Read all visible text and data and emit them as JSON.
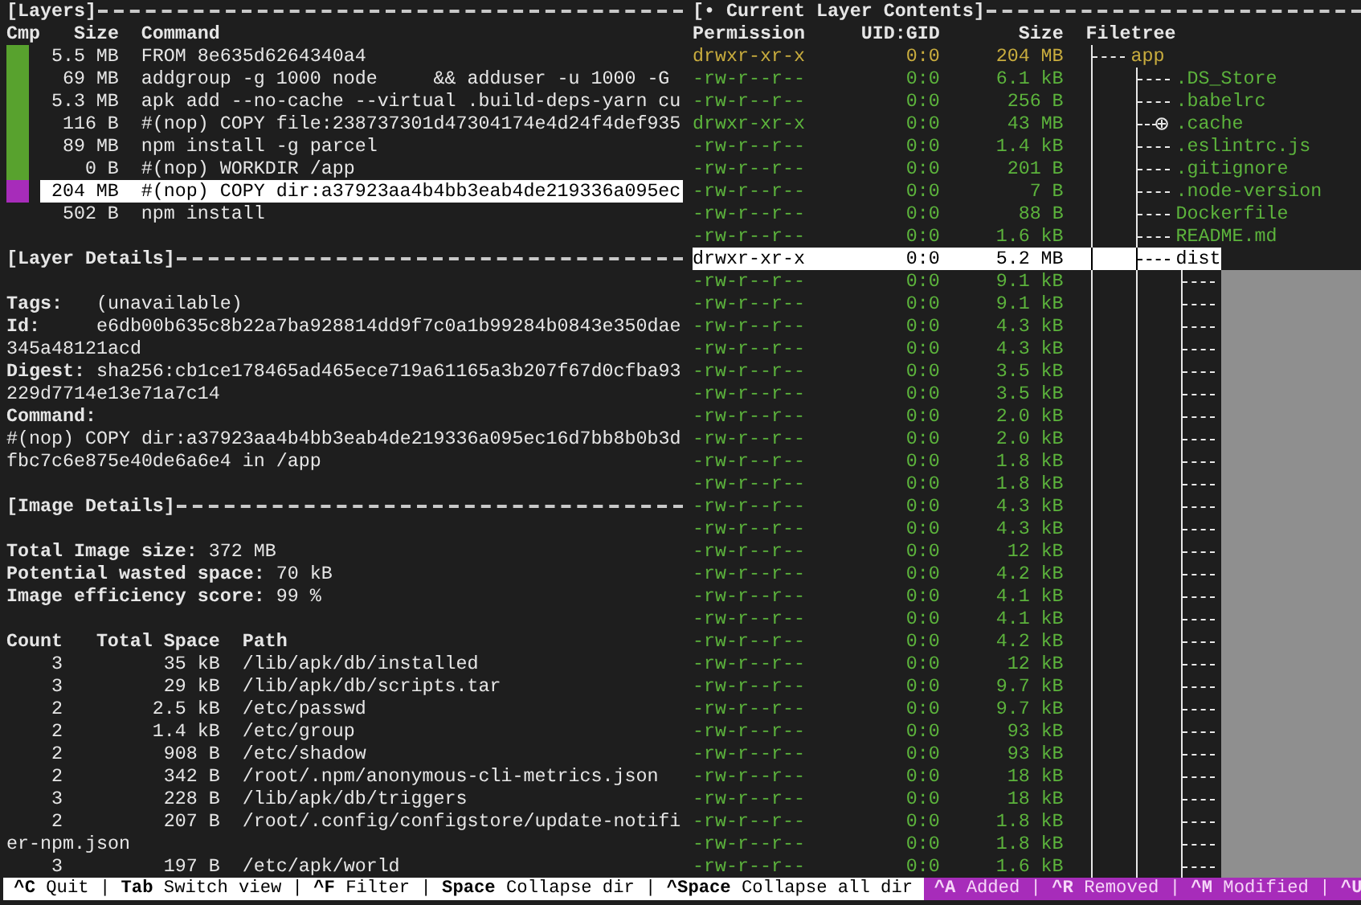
{
  "layers_pane": {
    "title": "[Layers]",
    "columns": [
      "Cmp",
      "Size",
      "Command"
    ],
    "rows": [
      {
        "color": "#58a22e",
        "size": "5.5 MB",
        "command": "FROM 8e635d6264340a4",
        "selected": false
      },
      {
        "color": "#58a22e",
        "size": "69 MB",
        "command": "addgroup -g 1000 node     && adduser -u 1000 -G",
        "selected": false
      },
      {
        "color": "#58a22e",
        "size": "5.3 MB",
        "command": "apk add --no-cache --virtual .build-deps-yarn cu",
        "selected": false
      },
      {
        "color": "#58a22e",
        "size": "116 B",
        "command": "#(nop) COPY file:238737301d47304174e4d24f4def935",
        "selected": false
      },
      {
        "color": "#58a22e",
        "size": "89 MB",
        "command": "npm install -g parcel",
        "selected": false
      },
      {
        "color": "#58a22e",
        "size": "0 B",
        "command": "#(nop) WORKDIR /app",
        "selected": false
      },
      {
        "color": "#a72cba",
        "size": "204 MB",
        "command": "#(nop) COPY dir:a37923aa4b4bb3eab4de219336a095ec",
        "selected": true
      },
      {
        "size": "502 B",
        "command": "npm install",
        "selected": false
      }
    ]
  },
  "layer_details": {
    "title": "[Layer Details]",
    "fields": [
      {
        "kind": "inline",
        "label": "Tags:",
        "lines": [
          "(unavailable)"
        ]
      },
      {
        "kind": "inline",
        "label": "Id:",
        "lines": [
          "e6db00b635c8b22a7ba928814dd9f7c0a1b99284b0843e350dae",
          "345a48121acd"
        ]
      },
      {
        "kind": "inline",
        "label": "Digest:",
        "lines": [
          "sha256:cb1ce178465ad465ece719a61165a3b207f67d0cfba93",
          "229d7714e13e71a7c14"
        ]
      },
      {
        "kind": "block",
        "label": "Command:",
        "lines": [
          "#(nop) COPY dir:a37923aa4b4bb3eab4de219336a095ec16d7bb8b0b3d",
          "fbc7c6e875e40de6a6e4 in /app"
        ]
      }
    ]
  },
  "image_details": {
    "title": "[Image Details]",
    "stats": [
      {
        "label": "Total Image size:",
        "value": "372 MB"
      },
      {
        "label": "Potential wasted space:",
        "value": "70 kB"
      },
      {
        "label": "Image efficiency score:",
        "value": "99 %"
      }
    ],
    "table": {
      "columns": [
        "Count",
        "Total Space",
        "Path"
      ],
      "rows": [
        {
          "count": "3",
          "total_space": "35 kB",
          "path_lines": [
            "/lib/apk/db/installed"
          ]
        },
        {
          "count": "3",
          "total_space": "29 kB",
          "path_lines": [
            "/lib/apk/db/scripts.tar"
          ]
        },
        {
          "count": "2",
          "total_space": "2.5 kB",
          "path_lines": [
            "/etc/passwd"
          ]
        },
        {
          "count": "2",
          "total_space": "1.4 kB",
          "path_lines": [
            "/etc/group"
          ]
        },
        {
          "count": "2",
          "total_space": "908 B",
          "path_lines": [
            "/etc/shadow"
          ]
        },
        {
          "count": "2",
          "total_space": "342 B",
          "path_lines": [
            "/root/.npm/anonymous-cli-metrics.json"
          ]
        },
        {
          "count": "3",
          "total_space": "228 B",
          "path_lines": [
            "/lib/apk/db/triggers"
          ]
        },
        {
          "count": "2",
          "total_space": "207 B",
          "path_lines": [
            "/root/.config/configstore/update-notifi",
            "er-npm.json"
          ]
        },
        {
          "count": "3",
          "total_space": "197 B",
          "path_lines": [
            "/etc/apk/world"
          ]
        }
      ]
    }
  },
  "contents_pane": {
    "title": "[• Current Layer Contents]",
    "columns": [
      "Permission",
      "UID:GID",
      "Size",
      "Filetree"
    ],
    "tree": [
      {
        "permission": "drwxr-xr-x",
        "uid_gid": "0:0",
        "size": "204 MB",
        "name": "app",
        "color": "#c8ac3e",
        "selected": false,
        "collapsed": false,
        "children": [
          {
            "permission": "-rw-r--r--",
            "uid_gid": "0:0",
            "size": "6.1 kB",
            "name": ".DS_Store",
            "color": "#5cb33c",
            "selected": false,
            "collapsed": false
          },
          {
            "permission": "-rw-r--r--",
            "uid_gid": "0:0",
            "size": "256 B",
            "name": ".babelrc",
            "color": "#5cb33c",
            "selected": false,
            "collapsed": false
          },
          {
            "permission": "drwxr-xr-x",
            "uid_gid": "0:0",
            "size": "43 MB",
            "name": ".cache",
            "color": "#5cb33c",
            "selected": false,
            "collapsed": true
          },
          {
            "permission": "-rw-r--r--",
            "uid_gid": "0:0",
            "size": "1.4 kB",
            "name": ".eslintrc.js",
            "color": "#5cb33c",
            "selected": false,
            "collapsed": false
          },
          {
            "permission": "-rw-r--r--",
            "uid_gid": "0:0",
            "size": "201 B",
            "name": ".gitignore",
            "color": "#5cb33c",
            "selected": false,
            "collapsed": false
          },
          {
            "permission": "-rw-r--r--",
            "uid_gid": "0:0",
            "size": "7 B",
            "name": ".node-version",
            "color": "#5cb33c",
            "selected": false,
            "collapsed": false
          },
          {
            "permission": "-rw-r--r--",
            "uid_gid": "0:0",
            "size": "88 B",
            "name": "Dockerfile",
            "color": "#5cb33c",
            "selected": false,
            "collapsed": false
          },
          {
            "permission": "-rw-r--r--",
            "uid_gid": "0:0",
            "size": "1.6 kB",
            "name": "README.md",
            "color": "#5cb33c",
            "selected": false,
            "collapsed": false
          },
          {
            "permission": "drwxr-xr-x",
            "uid_gid": "0:0",
            "size": "5.2 MB",
            "name": "dist",
            "selected": true,
            "collapsed": false,
            "children": [
              {
                "permission": "-rw-r--r--",
                "uid_gid": "0:0",
                "size": "9.1 kB",
                "color": "#5cb33c",
                "selected": false
              },
              {
                "permission": "-rw-r--r--",
                "uid_gid": "0:0",
                "size": "9.1 kB",
                "color": "#5cb33c",
                "selected": false
              },
              {
                "permission": "-rw-r--r--",
                "uid_gid": "0:0",
                "size": "4.3 kB",
                "color": "#5cb33c",
                "selected": false
              },
              {
                "permission": "-rw-r--r--",
                "uid_gid": "0:0",
                "size": "4.3 kB",
                "color": "#5cb33c",
                "selected": false
              },
              {
                "permission": "-rw-r--r--",
                "uid_gid": "0:0",
                "size": "3.5 kB",
                "color": "#5cb33c",
                "selected": false
              },
              {
                "permission": "-rw-r--r--",
                "uid_gid": "0:0",
                "size": "3.5 kB",
                "color": "#5cb33c",
                "selected": false
              },
              {
                "permission": "-rw-r--r--",
                "uid_gid": "0:0",
                "size": "2.0 kB",
                "color": "#5cb33c",
                "selected": false
              },
              {
                "permission": "-rw-r--r--",
                "uid_gid": "0:0",
                "size": "2.0 kB",
                "color": "#5cb33c",
                "selected": false
              },
              {
                "permission": "-rw-r--r--",
                "uid_gid": "0:0",
                "size": "1.8 kB",
                "color": "#5cb33c",
                "selected": false
              },
              {
                "permission": "-rw-r--r--",
                "uid_gid": "0:0",
                "size": "1.8 kB",
                "color": "#5cb33c",
                "selected": false
              },
              {
                "permission": "-rw-r--r--",
                "uid_gid": "0:0",
                "size": "4.3 kB",
                "color": "#5cb33c",
                "selected": false
              },
              {
                "permission": "-rw-r--r--",
                "uid_gid": "0:0",
                "size": "4.3 kB",
                "color": "#5cb33c",
                "selected": false
              },
              {
                "permission": "-rw-r--r--",
                "uid_gid": "0:0",
                "size": "12 kB",
                "color": "#5cb33c",
                "selected": false
              },
              {
                "permission": "-rw-r--r--",
                "uid_gid": "0:0",
                "size": "4.2 kB",
                "color": "#5cb33c",
                "selected": false
              },
              {
                "permission": "-rw-r--r--",
                "uid_gid": "0:0",
                "size": "4.1 kB",
                "color": "#5cb33c",
                "selected": false
              },
              {
                "permission": "-rw-r--r--",
                "uid_gid": "0:0",
                "size": "4.1 kB",
                "color": "#5cb33c",
                "selected": false
              },
              {
                "permission": "-rw-r--r--",
                "uid_gid": "0:0",
                "size": "4.2 kB",
                "color": "#5cb33c",
                "selected": false
              },
              {
                "permission": "-rw-r--r--",
                "uid_gid": "0:0",
                "size": "12 kB",
                "color": "#5cb33c",
                "selected": false
              },
              {
                "permission": "-rw-r--r--",
                "uid_gid": "0:0",
                "size": "9.7 kB",
                "color": "#5cb33c",
                "selected": false
              },
              {
                "permission": "-rw-r--r--",
                "uid_gid": "0:0",
                "size": "9.7 kB",
                "color": "#5cb33c",
                "selected": false
              },
              {
                "permission": "-rw-r--r--",
                "uid_gid": "0:0",
                "size": "93 kB",
                "color": "#5cb33c",
                "selected": false
              },
              {
                "permission": "-rw-r--r--",
                "uid_gid": "0:0",
                "size": "93 kB",
                "color": "#5cb33c",
                "selected": false
              },
              {
                "permission": "-rw-r--r--",
                "uid_gid": "0:0",
                "size": "18 kB",
                "color": "#5cb33c",
                "selected": false
              },
              {
                "permission": "-rw-r--r--",
                "uid_gid": "0:0",
                "size": "18 kB",
                "color": "#5cb33c",
                "selected": false
              },
              {
                "permission": "-rw-r--r--",
                "uid_gid": "0:0",
                "size": "1.8 kB",
                "color": "#5cb33c",
                "selected": false
              },
              {
                "permission": "-rw-r--r--",
                "uid_gid": "0:0",
                "size": "1.8 kB",
                "color": "#5cb33c",
                "selected": false
              },
              {
                "permission": "-rw-r--r--",
                "uid_gid": "0:0",
                "size": "1.6 kB",
                "color": "#5cb33c",
                "selected": false
              }
            ]
          }
        ]
      }
    ]
  },
  "status_bar": {
    "keys": [
      {
        "key": "^C",
        "label": "Quit"
      },
      {
        "sep": "|",
        "key": "Tab",
        "label": "Switch view"
      },
      {
        "sep": "|",
        "key": "^F",
        "label": "Filter"
      },
      {
        "sep": "|",
        "key": "Space",
        "label": "Collapse dir"
      },
      {
        "sep": "|",
        "key": "^Space",
        "label": "Collapse all dir"
      }
    ],
    "filters": [
      {
        "key": "^A",
        "label": "Added"
      },
      {
        "sep": "|",
        "key": "^R",
        "label": "Removed"
      },
      {
        "sep": "|",
        "key": "^M",
        "label": "Modified"
      },
      {
        "sep": "|",
        "key": "^U"
      }
    ]
  }
}
